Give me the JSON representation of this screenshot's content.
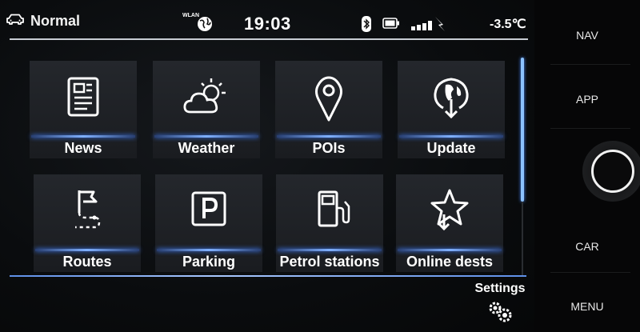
{
  "status": {
    "profile_label": "Normal",
    "wlan_label": "WLAN",
    "time": "19:03",
    "temperature": "-3.5℃"
  },
  "tiles": [
    {
      "label": "News",
      "icon": "news-icon"
    },
    {
      "label": "Weather",
      "icon": "weather-icon"
    },
    {
      "label": "POIs",
      "icon": "location-pin-icon"
    },
    {
      "label": "Update",
      "icon": "globe-download-icon"
    },
    {
      "label": "Routes",
      "icon": "route-flag-icon"
    },
    {
      "label": "Parking",
      "icon": "parking-icon"
    },
    {
      "label": "Petrol stations",
      "icon": "fuel-pump-icon"
    },
    {
      "label": "Online dests",
      "icon": "star-download-icon"
    }
  ],
  "settings": {
    "label": "Settings",
    "icon": "gears-icon"
  },
  "hardware_buttons": {
    "nav": "NAV",
    "app": "APP",
    "car": "CAR",
    "menu": "MENU"
  },
  "colors": {
    "accent": "#7fb0ff",
    "background": "#0a0c0e",
    "tile": "#202328"
  }
}
